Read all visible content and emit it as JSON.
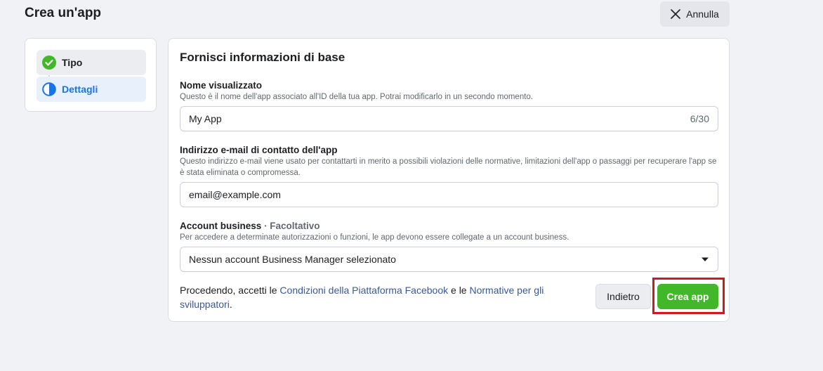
{
  "header": {
    "title": "Crea un'app",
    "cancel_label": "Annulla"
  },
  "steps": [
    {
      "label": "Tipo",
      "state": "completed",
      "icon": "check-circle-icon"
    },
    {
      "label": "Dettagli",
      "state": "active",
      "icon": "half-circle-icon"
    }
  ],
  "form": {
    "title": "Fornisci informazioni di base",
    "display_name": {
      "label": "Nome visualizzato",
      "help": "Questo è il nome dell'app associato all'ID della tua app. Potrai modificarlo in un secondo momento.",
      "value": "My App",
      "counter": "6/30"
    },
    "contact_email": {
      "label": "Indirizzo e-mail di contatto dell'app",
      "help": "Questo indirizzo e-mail viene usato per contattarti in merito a possibili violazioni delle normative, limitazioni dell'app o passaggi per recuperare l'app se è stata eliminata o compromessa.",
      "value": "email@example.com"
    },
    "business_account": {
      "label": "Account business",
      "optional": " · Facoltativo",
      "help": "Per accedere a determinate autorizzazioni o funzioni, le app devono essere collegate a un account business.",
      "selected": "Nessun account Business Manager selezionato"
    }
  },
  "footer": {
    "terms_prefix": "Procedendo, accetti le ",
    "terms_link1": "Condizioni della Piattaforma Facebook",
    "terms_middle": " e le ",
    "terms_link2": "Normative per gli sviluppatori",
    "terms_suffix": ".",
    "back_label": "Indietro",
    "create_label": "Crea app"
  },
  "colors": {
    "primary": "#1b74e4",
    "success": "#42b72a",
    "highlight": "#d0191f"
  }
}
